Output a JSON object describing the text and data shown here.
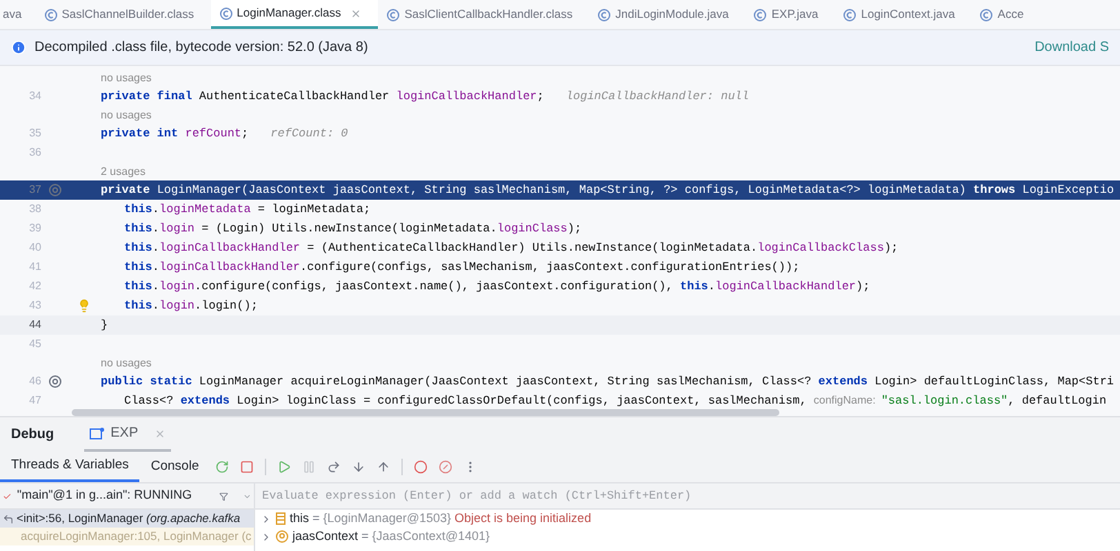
{
  "tabs": [
    {
      "label": "ava",
      "kind": "cut",
      "selected": false
    },
    {
      "label": "SaslChannelBuilder.class",
      "kind": "file",
      "selected": false
    },
    {
      "label": "LoginManager.class",
      "kind": "file",
      "selected": true
    },
    {
      "label": "SaslClientCallbackHandler.class",
      "kind": "file",
      "selected": false
    },
    {
      "label": "JndiLoginModule.java",
      "kind": "file",
      "selected": false
    },
    {
      "label": "EXP.java",
      "kind": "file",
      "selected": false
    },
    {
      "label": "LoginContext.java",
      "kind": "file",
      "selected": false
    },
    {
      "label": "Acce",
      "kind": "file",
      "selected": false
    }
  ],
  "info_bar": {
    "message": "Decompiled .class file, bytecode version: 52.0 (Java 8)",
    "link": "Download S"
  },
  "editor": {
    "lines": [
      {
        "kind": "usages",
        "text": "no usages"
      },
      {
        "kind": "member",
        "number": "34",
        "selected": false,
        "current": false,
        "override_marker": false,
        "intention_bulb": false,
        "segments": [
          {
            "kind": "kw",
            "text": "private final "
          },
          {
            "kind": "plain",
            "text": "AuthenticateCallbackHandler "
          },
          {
            "kind": "field",
            "text": "loginCallbackHandler"
          },
          {
            "kind": "plain",
            "text": ";"
          },
          {
            "kind": "hint",
            "text": "loginCallbackHandler: null"
          }
        ]
      },
      {
        "kind": "usages",
        "text": "no usages"
      },
      {
        "kind": "member",
        "number": "35",
        "selected": false,
        "current": false,
        "override_marker": false,
        "intention_bulb": false,
        "segments": [
          {
            "kind": "kw",
            "text": "private int "
          },
          {
            "kind": "field",
            "text": "refCount"
          },
          {
            "kind": "plain",
            "text": ";"
          },
          {
            "kind": "hint",
            "text": "refCount: 0"
          }
        ]
      },
      {
        "kind": "member",
        "number": "36",
        "selected": false,
        "current": false,
        "override_marker": false,
        "intention_bulb": false
      },
      {
        "kind": "usages",
        "text": "2 usages"
      },
      {
        "kind": "member",
        "number": "37",
        "selected": true,
        "current": false,
        "override_marker": true,
        "intention_bulb": false,
        "segments": [
          {
            "kind": "kw",
            "text": "private "
          },
          {
            "kind": "plain",
            "text": "LoginManager(JaasContext jaasContext, String saslMechanism, Map<String, ?> configs, LoginMetadata<?> loginMetadata) "
          },
          {
            "kind": "kw",
            "text": "throws "
          },
          {
            "kind": "plain",
            "text": "LoginExceptio"
          }
        ]
      },
      {
        "kind": "statement",
        "number": "38",
        "selected": false,
        "current": false,
        "override_marker": false,
        "intention_bulb": false,
        "segments": [
          {
            "kind": "kw",
            "text": "this"
          },
          {
            "kind": "plain",
            "text": "."
          },
          {
            "kind": "field",
            "text": "loginMetadata"
          },
          {
            "kind": "plain",
            "text": " = loginMetadata;"
          }
        ]
      },
      {
        "kind": "statement",
        "number": "39",
        "selected": false,
        "current": false,
        "override_marker": false,
        "intention_bulb": false,
        "segments": [
          {
            "kind": "kw",
            "text": "this"
          },
          {
            "kind": "plain",
            "text": "."
          },
          {
            "kind": "field",
            "text": "login"
          },
          {
            "kind": "plain",
            "text": " = (Login) Utils.newInstance(loginMetadata."
          },
          {
            "kind": "field",
            "text": "loginClass"
          },
          {
            "kind": "plain",
            "text": ");"
          }
        ]
      },
      {
        "kind": "statement",
        "number": "40",
        "selected": false,
        "current": false,
        "override_marker": false,
        "intention_bulb": false,
        "segments": [
          {
            "kind": "kw",
            "text": "this"
          },
          {
            "kind": "plain",
            "text": "."
          },
          {
            "kind": "field",
            "text": "loginCallbackHandler"
          },
          {
            "kind": "plain",
            "text": " = (AuthenticateCallbackHandler) Utils.newInstance(loginMetadata."
          },
          {
            "kind": "field",
            "text": "loginCallbackClass"
          },
          {
            "kind": "plain",
            "text": ");"
          }
        ]
      },
      {
        "kind": "statement",
        "number": "41",
        "selected": false,
        "current": false,
        "override_marker": false,
        "intention_bulb": false,
        "segments": [
          {
            "kind": "kw",
            "text": "this"
          },
          {
            "kind": "plain",
            "text": "."
          },
          {
            "kind": "field",
            "text": "loginCallbackHandler"
          },
          {
            "kind": "plain",
            "text": ".configure(configs, saslMechanism, jaasContext.configurationEntries());"
          }
        ]
      },
      {
        "kind": "statement",
        "number": "42",
        "selected": false,
        "current": false,
        "override_marker": false,
        "intention_bulb": false,
        "segments": [
          {
            "kind": "kw",
            "text": "this"
          },
          {
            "kind": "plain",
            "text": "."
          },
          {
            "kind": "field",
            "text": "login"
          },
          {
            "kind": "plain",
            "text": ".configure(configs, jaasContext.name(), jaasContext.configuration(), "
          },
          {
            "kind": "kw",
            "text": "this"
          },
          {
            "kind": "plain",
            "text": "."
          },
          {
            "kind": "field",
            "text": "loginCallbackHandler"
          },
          {
            "kind": "plain",
            "text": ");"
          }
        ]
      },
      {
        "kind": "statement",
        "number": "43",
        "selected": false,
        "current": false,
        "override_marker": false,
        "intention_bulb": true,
        "segments": [
          {
            "kind": "kw",
            "text": "this"
          },
          {
            "kind": "plain",
            "text": "."
          },
          {
            "kind": "field",
            "text": "login"
          },
          {
            "kind": "plain",
            "text": ".login();"
          }
        ]
      },
      {
        "kind": "member",
        "number": "44",
        "selected": false,
        "current": true,
        "override_marker": false,
        "intention_bulb": false,
        "segments": [
          {
            "kind": "plain",
            "text": "}"
          }
        ]
      },
      {
        "kind": "member",
        "number": "45",
        "selected": false,
        "current": false,
        "override_marker": false,
        "intention_bulb": false
      },
      {
        "kind": "usages",
        "text": "no usages"
      },
      {
        "kind": "member",
        "number": "46",
        "selected": false,
        "current": false,
        "override_marker": true,
        "intention_bulb": false,
        "segments": [
          {
            "kind": "kw",
            "text": "public static "
          },
          {
            "kind": "plain",
            "text": "LoginManager acquireLoginManager(JaasContext jaasContext, String saslMechanism, Class<? "
          },
          {
            "kind": "kw",
            "text": "extends "
          },
          {
            "kind": "plain",
            "text": "Login> defaultLoginClass, Map<Stri"
          }
        ]
      },
      {
        "kind": "statement",
        "number": "47",
        "selected": false,
        "current": false,
        "override_marker": false,
        "intention_bulb": false,
        "segments": [
          {
            "kind": "plain",
            "text": "Class<? "
          },
          {
            "kind": "kw",
            "text": "extends "
          },
          {
            "kind": "plain",
            "text": "Login> loginClass = configuredClassOrDefault(configs, jaasContext, saslMechanism, "
          },
          {
            "kind": "param",
            "text": "configName:"
          },
          {
            "kind": "string",
            "text": "\"sasl.login.class\""
          },
          {
            "kind": "plain",
            "text": ", defaultLogin"
          }
        ]
      }
    ]
  },
  "debug": {
    "title": "Debug",
    "session_tab": "EXP",
    "subtabs": [
      {
        "label": "Threads & Variables",
        "selected": true
      },
      {
        "label": "Console",
        "selected": false
      }
    ],
    "thread": "\"main\"@1 in g...ain\": RUNNING",
    "evaluate": {
      "placeholder": "Evaluate expression (Enter) or add a watch (Ctrl+Shift+Enter)"
    },
    "frames": [
      {
        "text": "<init>:56, LoginManager *(org.apache.kafka*",
        "selected": true
      },
      {
        "text": "acquireLoginManager:105, LoginManager (c",
        "selected": false
      }
    ],
    "variables": [
      {
        "kind": "field",
        "name": "this",
        "eq": " = ",
        "value": "{LoginManager@1503}",
        "note": "Object is being initialized"
      },
      {
        "kind": "param",
        "name": "jaasContext",
        "eq": " = ",
        "value": "{JaasContext@1401}"
      }
    ]
  }
}
